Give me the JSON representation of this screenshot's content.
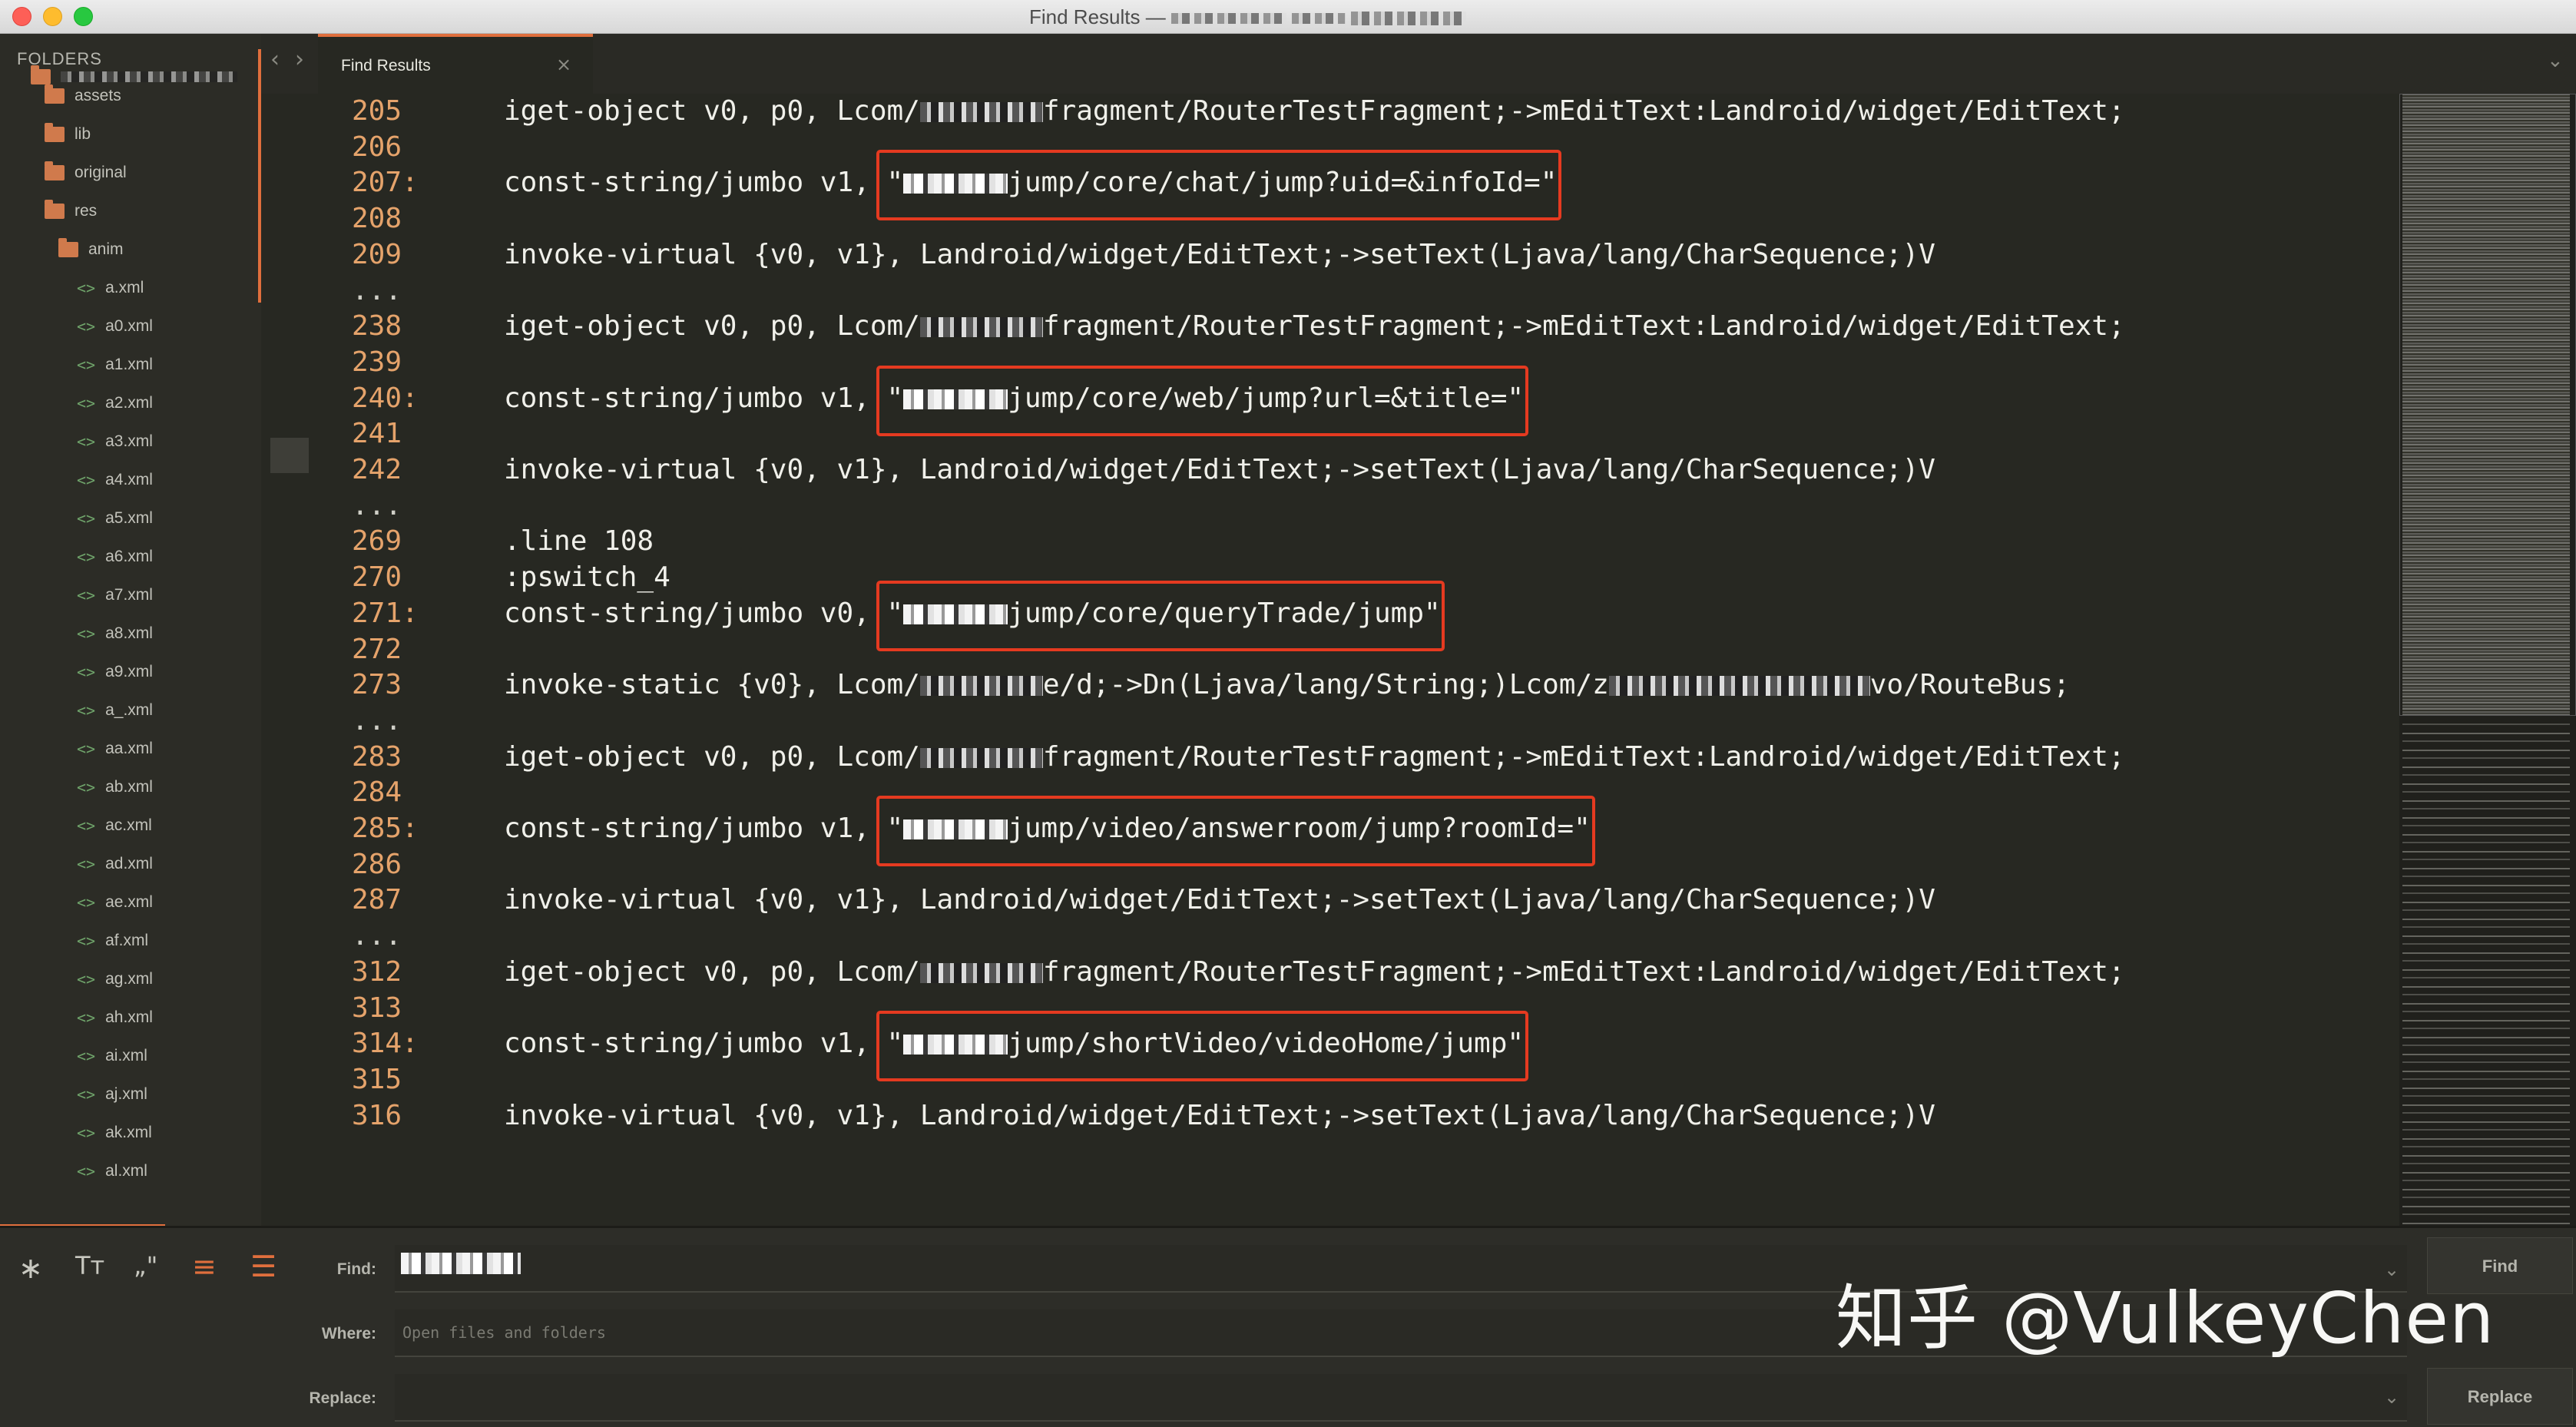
{
  "window": {
    "title": "Find Results —"
  },
  "sidebar": {
    "header": "FOLDERS",
    "items": [
      {
        "label": "assets",
        "type": "folder"
      },
      {
        "label": "lib",
        "type": "folder"
      },
      {
        "label": "original",
        "type": "folder"
      },
      {
        "label": "res",
        "type": "folder"
      },
      {
        "label": "anim",
        "type": "folder"
      },
      {
        "label": "a.xml",
        "type": "file"
      },
      {
        "label": "a0.xml",
        "type": "file"
      },
      {
        "label": "a1.xml",
        "type": "file"
      },
      {
        "label": "a2.xml",
        "type": "file"
      },
      {
        "label": "a3.xml",
        "type": "file"
      },
      {
        "label": "a4.xml",
        "type": "file"
      },
      {
        "label": "a5.xml",
        "type": "file"
      },
      {
        "label": "a6.xml",
        "type": "file"
      },
      {
        "label": "a7.xml",
        "type": "file"
      },
      {
        "label": "a8.xml",
        "type": "file"
      },
      {
        "label": "a9.xml",
        "type": "file"
      },
      {
        "label": "a_.xml",
        "type": "file"
      },
      {
        "label": "aa.xml",
        "type": "file"
      },
      {
        "label": "ab.xml",
        "type": "file"
      },
      {
        "label": "ac.xml",
        "type": "file"
      },
      {
        "label": "ad.xml",
        "type": "file"
      },
      {
        "label": "ae.xml",
        "type": "file"
      },
      {
        "label": "af.xml",
        "type": "file"
      },
      {
        "label": "ag.xml",
        "type": "file"
      },
      {
        "label": "ah.xml",
        "type": "file"
      },
      {
        "label": "ai.xml",
        "type": "file"
      },
      {
        "label": "aj.xml",
        "type": "file"
      },
      {
        "label": "ak.xml",
        "type": "file"
      },
      {
        "label": "al.xml",
        "type": "file"
      }
    ]
  },
  "tabs": [
    {
      "label": "Find Results",
      "close": "×"
    }
  ],
  "nav": {
    "back": "‹",
    "forward": "›",
    "overflow": "⌄"
  },
  "results": [
    {
      "ln": "205",
      "code": "iget-object v0, p0, Lcom/",
      "code2": "fragment/RouterTestFragment;->mEditText:Landroid/widget/EditText;",
      "redact": true
    },
    {
      "ln": "206"
    },
    {
      "ln": "207:",
      "code": "const-string/jumbo v1, \"",
      "code2": "jump/core/chat/jump?uid=&infoId=\"",
      "redact": true,
      "hl": true
    },
    {
      "ln": "208"
    },
    {
      "ln": "209",
      "code": "invoke-virtual {v0, v1}, Landroid/widget/EditText;->setText(Ljava/lang/CharSequence;)V"
    },
    {
      "ln": "...",
      "dots": true
    },
    {
      "ln": "238",
      "code": "iget-object v0, p0, Lcom/",
      "code2": "fragment/RouterTestFragment;->mEditText:Landroid/widget/EditText;",
      "redact": true
    },
    {
      "ln": "239"
    },
    {
      "ln": "240:",
      "code": "const-string/jumbo v1, \"",
      "code2": "jump/core/web/jump?url=&title=\"",
      "redact": true,
      "hl": true
    },
    {
      "ln": "241"
    },
    {
      "ln": "242",
      "code": "invoke-virtual {v0, v1}, Landroid/widget/EditText;->setText(Ljava/lang/CharSequence;)V"
    },
    {
      "ln": "...",
      "dots": true
    },
    {
      "ln": "269",
      "code": ".line 108"
    },
    {
      "ln": "270",
      "code": ":pswitch_4"
    },
    {
      "ln": "271:",
      "code": "const-string/jumbo v0, \"",
      "code2": "jump/core/queryTrade/jump\"",
      "redact": true,
      "hl": true
    },
    {
      "ln": "272"
    },
    {
      "ln": "273",
      "code": "invoke-static {v0}, Lcom/",
      "code2": "e/d;->Dn(Ljava/lang/String;)Lcom/z",
      "code3": "vo/RouteBus;",
      "redact": true,
      "redact2": true
    },
    {
      "ln": "...",
      "dots": true
    },
    {
      "ln": "283",
      "code": "iget-object v0, p0, Lcom/",
      "code2": "fragment/RouterTestFragment;->mEditText:Landroid/widget/EditText;",
      "redact": true
    },
    {
      "ln": "284"
    },
    {
      "ln": "285:",
      "code": "const-string/jumbo v1, \"",
      "code2": "jump/video/answerroom/jump?roomId=\"",
      "redact": true,
      "hl": true
    },
    {
      "ln": "286"
    },
    {
      "ln": "287",
      "code": "invoke-virtual {v0, v1}, Landroid/widget/EditText;->setText(Ljava/lang/CharSequence;)V"
    },
    {
      "ln": "...",
      "dots": true
    },
    {
      "ln": "312",
      "code": "iget-object v0, p0, Lcom/",
      "code2": "fragment/RouterTestFragment;->mEditText:Landroid/widget/EditText;",
      "redact": true
    },
    {
      "ln": "313"
    },
    {
      "ln": "314:",
      "code": "const-string/jumbo v1, \"",
      "code2": "jump/shortVideo/videoHome/jump\"",
      "redact": true,
      "hl": true
    },
    {
      "ln": "315"
    },
    {
      "ln": "316",
      "code": "invoke-virtual {v0, v1}, Landroid/widget/EditText;->setText(Ljava/lang/CharSequence;)V"
    }
  ],
  "find_panel": {
    "options": {
      "regex": "∗",
      "case": "Tт",
      "whole": "„\"",
      "wrap": "≡",
      "highlight": "☰"
    },
    "find_label": "Find:",
    "where_label": "Where:",
    "replace_label": "Replace:",
    "where_placeholder": "Open files and folders",
    "find_button": "Find",
    "replace_button": "Replace",
    "dropdown": "⌄"
  },
  "watermark": "知乎 @VulkeyChen",
  "colors": {
    "accent": "#e06f3d",
    "highlight_box": "#e53a20",
    "line_number": "#e5a36b"
  }
}
